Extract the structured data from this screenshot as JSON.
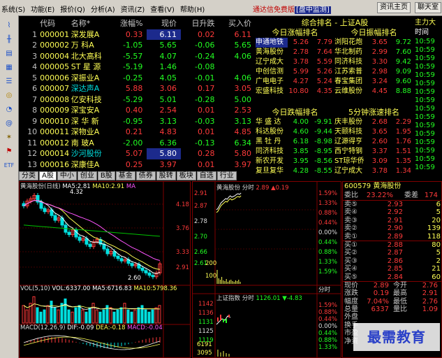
{
  "menu": {
    "items": [
      "系统(S)",
      "功能(E)",
      "报价(Q)",
      "分析(A)",
      "资讯(Z)",
      "查看(V)",
      "帮助(H)"
    ],
    "app_title": "通达信免费版",
    "mode": "[盘中监测]",
    "buttons": [
      "资讯主页",
      "聊天室"
    ]
  },
  "sidebar": {
    "icons": [
      "line-chart-icon",
      "kline-icon",
      "bar-icon",
      "grid-icon",
      "table-icon",
      "coin-icon",
      "clock-icon",
      "at-icon",
      "settings-icon",
      "flag-icon",
      "etf-icon"
    ],
    "etf_label": "ETF"
  },
  "quote_table": {
    "headers": [
      "",
      "代码",
      "名称*",
      "涨幅%",
      "现价",
      "日升跌",
      "买入价"
    ],
    "rows": [
      {
        "idx": "1",
        "code": "000001",
        "name": "深发展A",
        "pct": "0.33",
        "price": "6.11",
        "chg": "0.02",
        "buy": "6.11",
        "dir": "up",
        "sel": true
      },
      {
        "idx": "2",
        "code": "000002",
        "name": "万 科A",
        "pct": "-1.05",
        "price": "5.65",
        "chg": "-0.06",
        "buy": "5.65",
        "dir": "down"
      },
      {
        "idx": "3",
        "code": "000004",
        "name": "北大高科",
        "pct": "-5.57",
        "price": "4.07",
        "chg": "-0.24",
        "buy": "4.06",
        "dir": "down"
      },
      {
        "idx": "4",
        "code": "000005",
        "name": "ST 星 源",
        "pct": "-5.19",
        "price": "1.46",
        "chg": "-0.08",
        "buy": "",
        "dir": "down"
      },
      {
        "idx": "5",
        "code": "000006",
        "name": "深振业A",
        "pct": "-0.25",
        "price": "4.05",
        "chg": "-0.01",
        "buy": "4.06",
        "dir": "down"
      },
      {
        "idx": "6",
        "code": "000007",
        "name": "深达声A",
        "pct": "5.88",
        "price": "3.06",
        "chg": "0.17",
        "buy": "3.05",
        "dir": "up"
      },
      {
        "idx": "7",
        "code": "000008",
        "name": "亿安科技",
        "pct": "-5.29",
        "price": "5.01",
        "chg": "-0.28",
        "buy": "5.00",
        "dir": "down"
      },
      {
        "idx": "8",
        "code": "000009",
        "name": "深宝安A",
        "pct": "0.40",
        "price": "2.54",
        "chg": "0.01",
        "buy": "2.53",
        "dir": "up"
      },
      {
        "idx": "9",
        "code": "000010",
        "name": "深 华 新",
        "pct": "-0.95",
        "price": "3.13",
        "chg": "-0.03",
        "buy": "3.13",
        "dir": "down"
      },
      {
        "idx": "10",
        "code": "000011",
        "name": "深物业A",
        "pct": "0.21",
        "price": "4.83",
        "chg": "0.01",
        "buy": "4.85",
        "dir": "up"
      },
      {
        "idx": "11",
        "code": "000012",
        "name": "南 玻A",
        "pct": "-2.00",
        "price": "6.36",
        "chg": "-0.13",
        "buy": "6.34",
        "dir": "down"
      },
      {
        "idx": "12",
        "code": "000014",
        "name": "沙河股份",
        "pct": "5.07",
        "price": "5.80",
        "chg": "0.28",
        "buy": "5.80",
        "dir": "up"
      },
      {
        "idx": "13",
        "code": "000016",
        "name": "深康佳A",
        "pct": "0.25",
        "price": "3.97",
        "chg": "0.01",
        "buy": "3.97",
        "dir": "up"
      }
    ]
  },
  "market_tabs": [
    "分类",
    "A股",
    "中小",
    "创业",
    "B股",
    "基金",
    "债券",
    "股转",
    "板块",
    "自选",
    "行业"
  ],
  "ranking": {
    "title": "综合排名 - 上证A股",
    "rise": {
      "title": "今日涨幅排名",
      "rows": [
        {
          "n": "申通地铁",
          "p": "5.26",
          "v": "7.79"
        },
        {
          "n": "黄海股份",
          "p": "2.78",
          "v": "7.64"
        },
        {
          "n": "辽宁成大",
          "p": "3.78",
          "v": "5.59"
        },
        {
          "n": "中创信测",
          "p": "5.99",
          "v": "5.26"
        },
        {
          "n": "广电电子",
          "p": "4.27",
          "v": "5.24"
        },
        {
          "n": "宏盛科技",
          "p": "10.80",
          "v": "4.35"
        }
      ]
    },
    "amp": {
      "title": "今日振幅排名",
      "rows": [
        {
          "n": "浏阳花炮",
          "p": "3.65",
          "v": "9.72"
        },
        {
          "n": "华北制药",
          "p": "2.99",
          "v": "7.60"
        },
        {
          "n": "同济科技",
          "p": "3.30",
          "v": "9.42"
        },
        {
          "n": "江苏索普",
          "p": "2.98",
          "v": "9.09"
        },
        {
          "n": "春宝集团",
          "p": "3.24",
          "v": "9.60"
        },
        {
          "n": "云维股份",
          "p": "4.45",
          "v": "8.88"
        }
      ]
    },
    "fall": {
      "title": "今日跌幅排名",
      "rows": [
        {
          "n": "华 盛 达",
          "p": "4.00",
          "v": "-9.91"
        },
        {
          "n": "科达股份",
          "p": "4.60",
          "v": "-9.44"
        },
        {
          "n": "黑 牡 丹",
          "p": "6.18",
          "v": "-8.98"
        },
        {
          "n": "同济科技",
          "p": "3.85",
          "v": "-8.95"
        },
        {
          "n": "新农开发",
          "p": "3.95",
          "v": "-8.56"
        },
        {
          "n": "复旦复华",
          "p": "4.28",
          "v": "-8.55"
        }
      ]
    },
    "speed": {
      "title": "5分钟涨速排名",
      "rows": [
        {
          "n": "庆丰股份",
          "p": "2.68",
          "v": "2.29"
        },
        {
          "n": "天颐科技",
          "p": "3.65",
          "v": "1.95"
        },
        {
          "n": "辽源得亨",
          "p": "2.60",
          "v": "1.76"
        },
        {
          "n": "西宁特钢",
          "p": "3.37",
          "v": "1.51"
        },
        {
          "n": "ST琼华侨",
          "p": "3.09",
          "v": "1.35"
        },
        {
          "n": "辽宁成大",
          "p": "3.78",
          "v": "1.34"
        }
      ]
    }
  },
  "ticker": {
    "title": "主力大",
    "time_label": "时间",
    "rows": [
      "10:59",
      "10:59",
      "10:59",
      "10:59",
      "10:59",
      "10:59",
      "10:59",
      "10:59",
      "10:59",
      "10:59",
      "10:59",
      "10:59",
      "10:59",
      "10:59",
      "10:59",
      "10:59"
    ]
  },
  "kline": {
    "caption_name": "黄海股份(日线)",
    "ma5": "MA5:2.81",
    "ma10": "MA10:2.91",
    "ma_more": "MA",
    "high_mark": "4.32",
    "low_mark": "2.60",
    "vol_caption": "VOL(5,10)",
    "vol_val": "VOL:6337.00",
    "vol_ma5": "MA5:6716.83",
    "vol_ma10": "MA10:5798.36",
    "macd_caption": "MACD(12,26,9)",
    "dif": "DIF:-0.09",
    "dea": "DEA:-0.18",
    "macd": "MACD:-0.04"
  },
  "minute": {
    "price_axis": [
      "4.18",
      "3.76",
      "3.33",
      "2.91"
    ],
    "mini_axis": [
      "2.91",
      "2.87",
      "2.78",
      "2.70",
      "2.66",
      "2.61"
    ],
    "mini_pct": [
      "1.59%",
      "1.33%",
      "0.88%",
      "0.44%",
      "0.00%",
      "0.44%",
      "0.88%",
      "1.33%",
      "1.59%"
    ],
    "caption": "黄海股份",
    "time_label": "分时",
    "price": "2.89",
    "chg": "▲0.19",
    "vol_axis": [
      "200",
      "100"
    ],
    "vol_label": "分时",
    "index_caption": "上证指数",
    "index_time": "分时",
    "index_val": "1126.01",
    "index_chg": "▼-4.83",
    "index_axis": [
      "1142",
      "1136",
      "1131",
      "1125",
      "1119"
    ],
    "index_pct": [
      "1.59%",
      "0.88%",
      "0.44%",
      "0.00%",
      "0.44%",
      "0.88%",
      "1.33%"
    ],
    "index_vol_axis": [
      "6191",
      "3095"
    ]
  },
  "quote": {
    "code_name": "600579 黄海股份",
    "wb_label": "委比",
    "wb_val": "23.22%",
    "wc_label": "委差",
    "wc_val": "174",
    "sells": [
      {
        "lab": "卖⑤",
        "px": "2.93",
        "vol": "6"
      },
      {
        "lab": "卖④",
        "px": "2.92",
        "vol": "5"
      },
      {
        "lab": "卖③",
        "px": "2.91",
        "vol": "20"
      },
      {
        "lab": "卖②",
        "px": "2.90",
        "vol": "139"
      },
      {
        "lab": "卖①",
        "px": "2.89",
        "vol": "118"
      }
    ],
    "buys": [
      {
        "lab": "买①",
        "px": "2.88",
        "vol": "80"
      },
      {
        "lab": "买②",
        "px": "2.87",
        "vol": "5"
      },
      {
        "lab": "买③",
        "px": "2.86",
        "vol": "2"
      },
      {
        "lab": "买④",
        "px": "2.85",
        "vol": "21"
      },
      {
        "lab": "买⑤",
        "px": "2.84",
        "vol": "60"
      }
    ],
    "stats": [
      {
        "l": "现价",
        "v": "2.89",
        "l2": "今开",
        "v2": "2.76"
      },
      {
        "l": "涨跌",
        "v": "0.19",
        "l2": "最高",
        "v2": "2.91"
      },
      {
        "l": "幅度",
        "v": "7.04%",
        "l2": "最低",
        "v2": "2.76"
      },
      {
        "l": "总量",
        "v": "6337",
        "l2": "量比",
        "v2": "1.09"
      },
      {
        "l": "外盘",
        "v": "",
        "l2": "",
        "v2": ""
      },
      {
        "l": "换手",
        "v": "",
        "l2": "",
        "v2": ""
      },
      {
        "l": "市盈",
        "v": "",
        "l2": "",
        "v2": ""
      },
      {
        "l": "净资",
        "v": "",
        "l2": "",
        "v2": ""
      }
    ]
  },
  "watermark": "最需教育",
  "colors": {
    "up": "#ff3a3a",
    "down": "#22ff22",
    "name": "#ffff55",
    "border": "#800000"
  }
}
